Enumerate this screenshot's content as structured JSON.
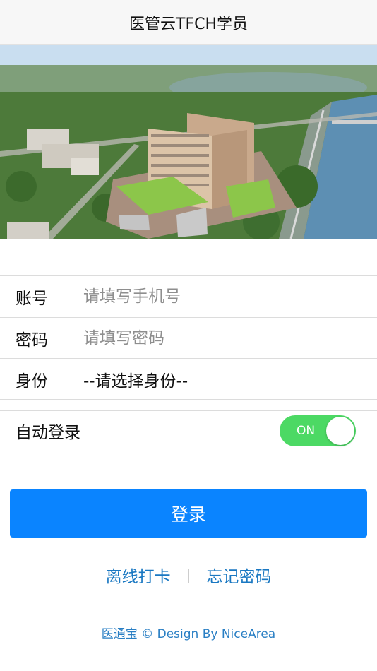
{
  "header": {
    "title": "医管云TFCH学员"
  },
  "banner": {
    "icon": "hospital-aerial-image"
  },
  "form": {
    "account_label": "账号",
    "account_placeholder": "请填写手机号",
    "password_label": "密码",
    "password_placeholder": "请填写密码",
    "role_label": "身份",
    "role_value": "--请选择身份--"
  },
  "auto_login": {
    "label": "自动登录",
    "toggle_text": "ON",
    "enabled": true
  },
  "login_button": {
    "label": "登录"
  },
  "links": {
    "offline_checkin": "离线打卡",
    "separator": "|",
    "forgot_password": "忘记密码"
  },
  "footer": {
    "text": "医通宝 © Design By NiceArea"
  },
  "colors": {
    "primary": "#0a84ff",
    "toggle_on": "#4cd964",
    "link": "#1a78c2"
  }
}
